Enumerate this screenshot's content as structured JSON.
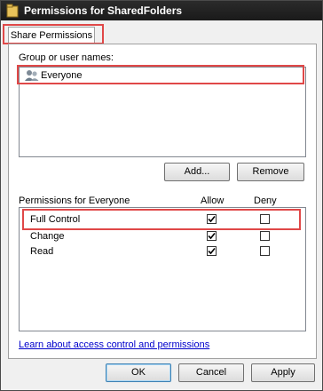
{
  "window": {
    "title": "Permissions for SharedFolders"
  },
  "tab": {
    "label": "Share Permissions"
  },
  "group_section": {
    "label": "Group or user names:",
    "users": [
      {
        "name": "Everyone"
      }
    ],
    "add_label": "Add...",
    "remove_label": "Remove"
  },
  "permissions": {
    "header": "Permissions for Everyone",
    "allow_header": "Allow",
    "deny_header": "Deny",
    "rows": [
      {
        "name": "Full Control",
        "allow": true,
        "deny": false
      },
      {
        "name": "Change",
        "allow": true,
        "deny": false
      },
      {
        "name": "Read",
        "allow": true,
        "deny": false
      }
    ]
  },
  "help_link": "Learn about access control and permissions",
  "footer": {
    "ok_label": "OK",
    "cancel_label": "Cancel",
    "apply_label": "Apply"
  },
  "colors": {
    "highlight": "#e04848",
    "link": "#0000cc"
  },
  "icons": {
    "window": "folder-icon",
    "user": "users-group-icon",
    "check": "checkmark-icon"
  }
}
